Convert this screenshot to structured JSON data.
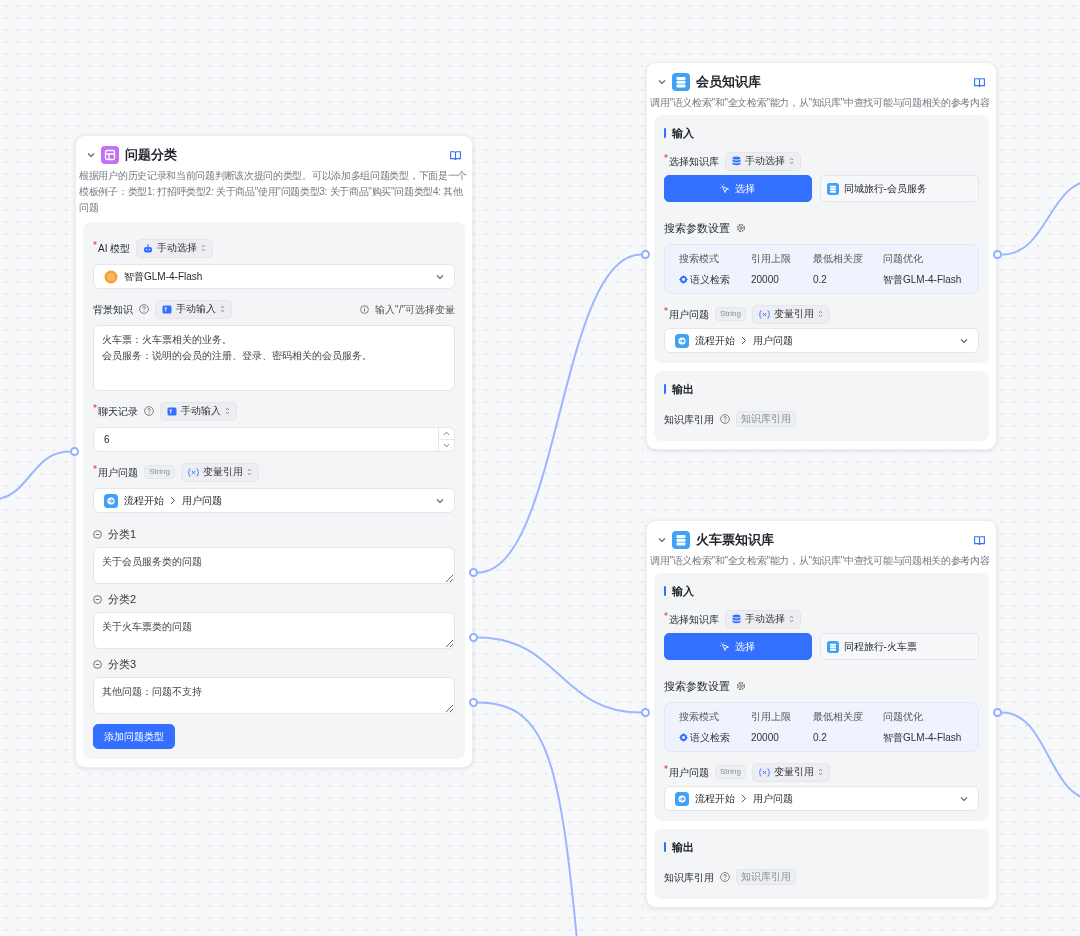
{
  "nodes": [
    {
      "kind": "classifier",
      "title": "问题分类",
      "description": "根据用户的历史记录和当前问题判断该次提问的类型。可以添加多组问题类型，下面是一个模板例子：类型1: 打招呼类型2: 关于商品\"使用\"问题类型3: 关于商品\"购买\"问题类型4: 其他问题",
      "model": {
        "label": "AI 模型",
        "required": true,
        "mode": "手动选择",
        "value": "智普GLM-4-Flash"
      },
      "background": {
        "label": "背景知识",
        "required": false,
        "mode": "手动输入",
        "hint": "输入\"/\"可选择变量",
        "lines": [
          "火车票：火车票相关的业务。",
          "会员服务：说明的会员的注册、登录、密码相关的会员服务。"
        ]
      },
      "history": {
        "label": "聊天记录",
        "required": true,
        "mode": "手动输入",
        "value": "6"
      },
      "question": {
        "label": "用户问题",
        "required": true,
        "type": "String",
        "mode": "变量引用",
        "source": "流程开始",
        "field": "用户问题"
      },
      "categories": [
        {
          "label": "分类1",
          "value": "关于会员服务类的问题"
        },
        {
          "label": "分类2",
          "value": "关于火车票类的问题"
        },
        {
          "label": "分类3",
          "value": "其他问题：问题不支持"
        }
      ],
      "add_button": "添加问题类型"
    },
    {
      "kind": "knowledge",
      "title": "会员知识库",
      "description": "调用\"语义检索\"和\"全文检索\"能力，从\"知识库\"中查找可能与问题相关的参考内容",
      "input_title": "输入",
      "dataset": {
        "label": "选择知识库",
        "required": true,
        "mode": "手动选择",
        "button": "选择",
        "selected": "同城旅行-会员服务"
      },
      "params_title": "搜索参数设置",
      "params": {
        "columns": [
          "搜索模式",
          "引用上限",
          "最低相关度",
          "问题优化"
        ],
        "values": [
          "语义检索",
          "20000",
          "0.2",
          "智普GLM-4-Flash"
        ]
      },
      "question": {
        "label": "用户问题",
        "required": true,
        "type": "String",
        "mode": "变量引用",
        "source": "流程开始",
        "field": "用户问题"
      },
      "output_title": "输出",
      "output": {
        "label": "知识库引用",
        "type": "知识库引用"
      }
    },
    {
      "kind": "knowledge",
      "title": "火车票知识库",
      "description": "调用\"语义检索\"和\"全文检索\"能力，从\"知识库\"中查找可能与问题相关的参考内容",
      "input_title": "输入",
      "dataset": {
        "label": "选择知识库",
        "required": true,
        "mode": "手动选择",
        "button": "选择",
        "selected": "同程旅行-火车票"
      },
      "params_title": "搜索参数设置",
      "params": {
        "columns": [
          "搜索模式",
          "引用上限",
          "最低相关度",
          "问题优化"
        ],
        "values": [
          "语义检索",
          "20000",
          "0.2",
          "智普GLM-4-Flash"
        ]
      },
      "question": {
        "label": "用户问题",
        "required": true,
        "type": "String",
        "mode": "变量引用",
        "source": "流程开始",
        "field": "用户问题"
      },
      "output_title": "输出",
      "output": {
        "label": "知识库引用",
        "type": "知识库引用"
      }
    }
  ]
}
